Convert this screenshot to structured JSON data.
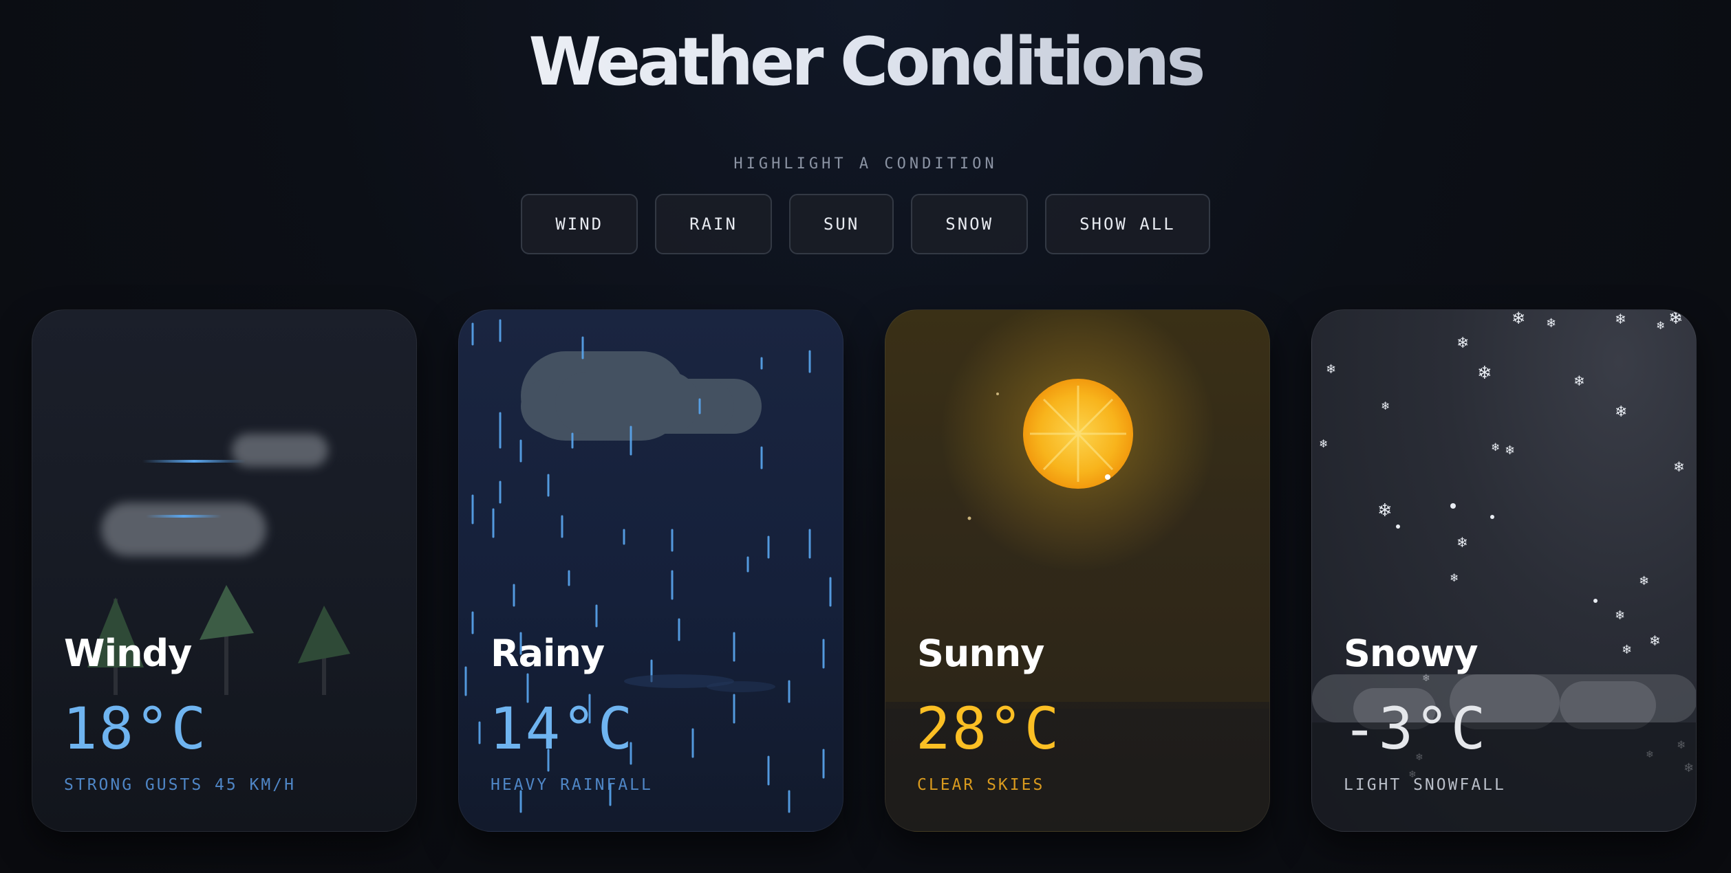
{
  "page": {
    "title": "Weather Conditions",
    "subtitle": "HIGHLIGHT A CONDITION"
  },
  "filters": [
    {
      "label": "WIND"
    },
    {
      "label": "RAIN"
    },
    {
      "label": "SUN"
    },
    {
      "label": "SNOW"
    },
    {
      "label": "SHOW ALL"
    }
  ],
  "cards": [
    {
      "name": "Windy",
      "temp": "18°C",
      "desc": "STRONG GUSTS 45 KM/H",
      "accent": "#6fb4f0",
      "desc_color": "#4f86c6",
      "icon": "wind-cloud-icon"
    },
    {
      "name": "Rainy",
      "temp": "14°C",
      "desc": "HEAVY RAINFALL",
      "accent": "#6fb4f0",
      "desc_color": "#4f86c6",
      "icon": "rain-cloud-icon"
    },
    {
      "name": "Sunny",
      "temp": "28°C",
      "desc": "CLEAR SKIES",
      "accent": "#fbbf24",
      "desc_color": "#d99a1e",
      "icon": "sun-icon"
    },
    {
      "name": "Snowy",
      "temp": "-3°C",
      "desc": "LIGHT SNOWFALL",
      "accent": "#e5e7eb",
      "desc_color": "#b9bec8",
      "icon": "snowflake-icon"
    }
  ]
}
